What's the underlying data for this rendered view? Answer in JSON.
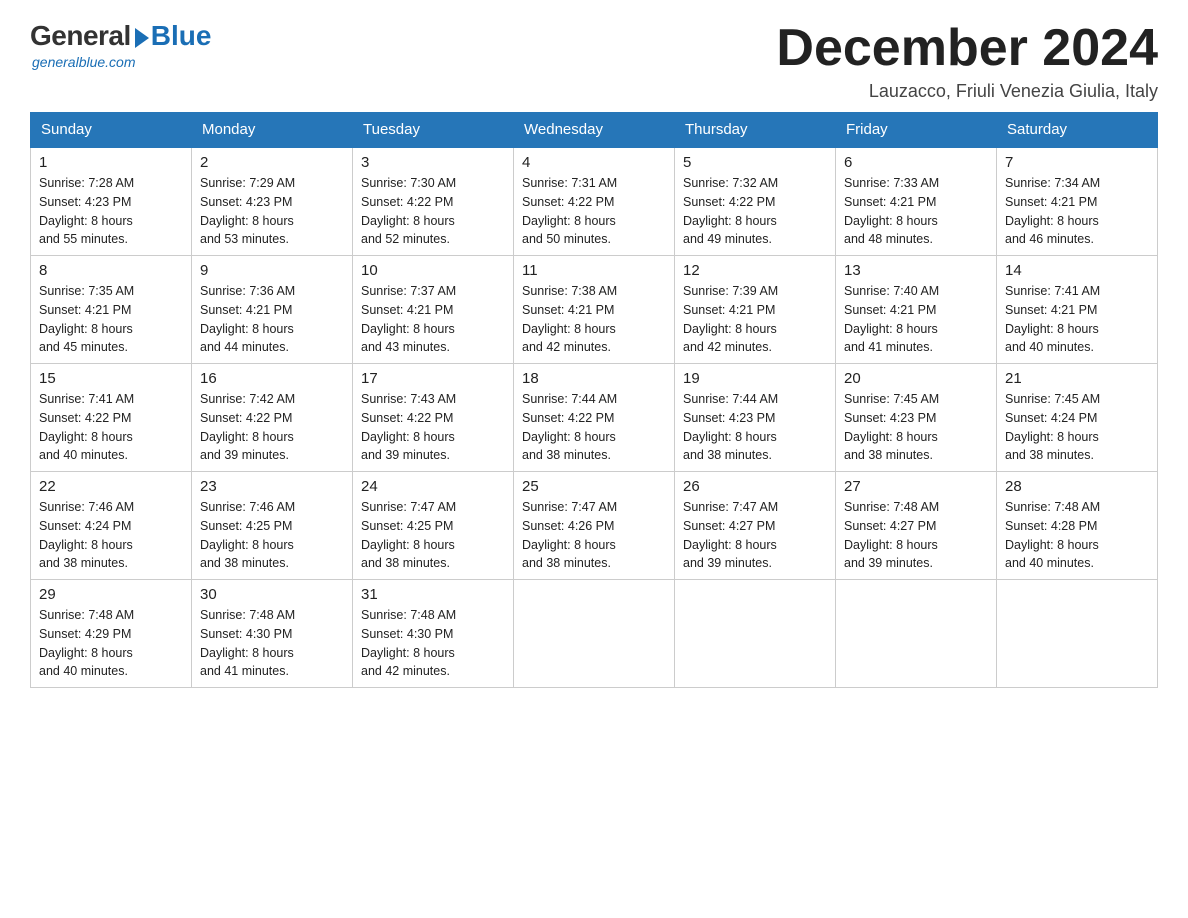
{
  "logo": {
    "general": "General",
    "blue": "Blue",
    "tagline": "generalblue.com"
  },
  "title": "December 2024",
  "location": "Lauzacco, Friuli Venezia Giulia, Italy",
  "days_of_week": [
    "Sunday",
    "Monday",
    "Tuesday",
    "Wednesday",
    "Thursday",
    "Friday",
    "Saturday"
  ],
  "weeks": [
    [
      {
        "day": "1",
        "sunrise": "7:28 AM",
        "sunset": "4:23 PM",
        "daylight": "8 hours and 55 minutes."
      },
      {
        "day": "2",
        "sunrise": "7:29 AM",
        "sunset": "4:23 PM",
        "daylight": "8 hours and 53 minutes."
      },
      {
        "day": "3",
        "sunrise": "7:30 AM",
        "sunset": "4:22 PM",
        "daylight": "8 hours and 52 minutes."
      },
      {
        "day": "4",
        "sunrise": "7:31 AM",
        "sunset": "4:22 PM",
        "daylight": "8 hours and 50 minutes."
      },
      {
        "day": "5",
        "sunrise": "7:32 AM",
        "sunset": "4:22 PM",
        "daylight": "8 hours and 49 minutes."
      },
      {
        "day": "6",
        "sunrise": "7:33 AM",
        "sunset": "4:21 PM",
        "daylight": "8 hours and 48 minutes."
      },
      {
        "day": "7",
        "sunrise": "7:34 AM",
        "sunset": "4:21 PM",
        "daylight": "8 hours and 46 minutes."
      }
    ],
    [
      {
        "day": "8",
        "sunrise": "7:35 AM",
        "sunset": "4:21 PM",
        "daylight": "8 hours and 45 minutes."
      },
      {
        "day": "9",
        "sunrise": "7:36 AM",
        "sunset": "4:21 PM",
        "daylight": "8 hours and 44 minutes."
      },
      {
        "day": "10",
        "sunrise": "7:37 AM",
        "sunset": "4:21 PM",
        "daylight": "8 hours and 43 minutes."
      },
      {
        "day": "11",
        "sunrise": "7:38 AM",
        "sunset": "4:21 PM",
        "daylight": "8 hours and 42 minutes."
      },
      {
        "day": "12",
        "sunrise": "7:39 AM",
        "sunset": "4:21 PM",
        "daylight": "8 hours and 42 minutes."
      },
      {
        "day": "13",
        "sunrise": "7:40 AM",
        "sunset": "4:21 PM",
        "daylight": "8 hours and 41 minutes."
      },
      {
        "day": "14",
        "sunrise": "7:41 AM",
        "sunset": "4:21 PM",
        "daylight": "8 hours and 40 minutes."
      }
    ],
    [
      {
        "day": "15",
        "sunrise": "7:41 AM",
        "sunset": "4:22 PM",
        "daylight": "8 hours and 40 minutes."
      },
      {
        "day": "16",
        "sunrise": "7:42 AM",
        "sunset": "4:22 PM",
        "daylight": "8 hours and 39 minutes."
      },
      {
        "day": "17",
        "sunrise": "7:43 AM",
        "sunset": "4:22 PM",
        "daylight": "8 hours and 39 minutes."
      },
      {
        "day": "18",
        "sunrise": "7:44 AM",
        "sunset": "4:22 PM",
        "daylight": "8 hours and 38 minutes."
      },
      {
        "day": "19",
        "sunrise": "7:44 AM",
        "sunset": "4:23 PM",
        "daylight": "8 hours and 38 minutes."
      },
      {
        "day": "20",
        "sunrise": "7:45 AM",
        "sunset": "4:23 PM",
        "daylight": "8 hours and 38 minutes."
      },
      {
        "day": "21",
        "sunrise": "7:45 AM",
        "sunset": "4:24 PM",
        "daylight": "8 hours and 38 minutes."
      }
    ],
    [
      {
        "day": "22",
        "sunrise": "7:46 AM",
        "sunset": "4:24 PM",
        "daylight": "8 hours and 38 minutes."
      },
      {
        "day": "23",
        "sunrise": "7:46 AM",
        "sunset": "4:25 PM",
        "daylight": "8 hours and 38 minutes."
      },
      {
        "day": "24",
        "sunrise": "7:47 AM",
        "sunset": "4:25 PM",
        "daylight": "8 hours and 38 minutes."
      },
      {
        "day": "25",
        "sunrise": "7:47 AM",
        "sunset": "4:26 PM",
        "daylight": "8 hours and 38 minutes."
      },
      {
        "day": "26",
        "sunrise": "7:47 AM",
        "sunset": "4:27 PM",
        "daylight": "8 hours and 39 minutes."
      },
      {
        "day": "27",
        "sunrise": "7:48 AM",
        "sunset": "4:27 PM",
        "daylight": "8 hours and 39 minutes."
      },
      {
        "day": "28",
        "sunrise": "7:48 AM",
        "sunset": "4:28 PM",
        "daylight": "8 hours and 40 minutes."
      }
    ],
    [
      {
        "day": "29",
        "sunrise": "7:48 AM",
        "sunset": "4:29 PM",
        "daylight": "8 hours and 40 minutes."
      },
      {
        "day": "30",
        "sunrise": "7:48 AM",
        "sunset": "4:30 PM",
        "daylight": "8 hours and 41 minutes."
      },
      {
        "day": "31",
        "sunrise": "7:48 AM",
        "sunset": "4:30 PM",
        "daylight": "8 hours and 42 minutes."
      },
      null,
      null,
      null,
      null
    ]
  ],
  "labels": {
    "sunrise": "Sunrise:",
    "sunset": "Sunset:",
    "daylight": "Daylight:"
  }
}
